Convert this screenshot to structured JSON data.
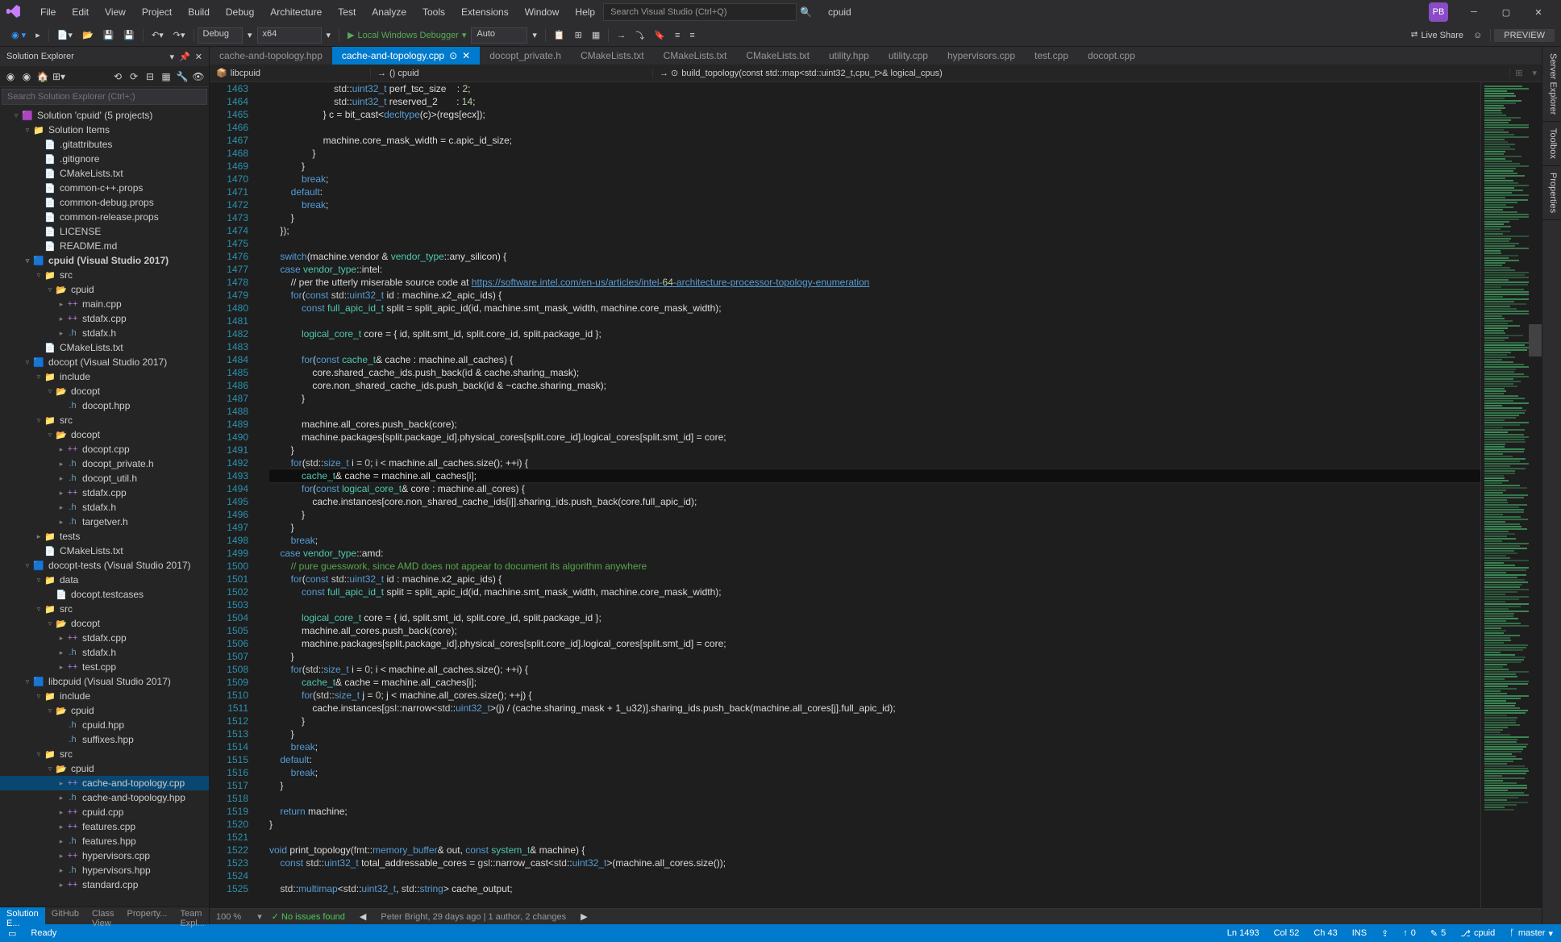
{
  "titlebar": {
    "menus": [
      "File",
      "Edit",
      "View",
      "Project",
      "Build",
      "Debug",
      "Architecture",
      "Test",
      "Analyze",
      "Tools",
      "Extensions",
      "Window",
      "Help"
    ],
    "search_placeholder": "Search Visual Studio (Ctrl+Q)",
    "project_label": "cpuid",
    "user_initials": "PB"
  },
  "toolbar": {
    "config": "Debug",
    "platform": "x64",
    "debug_label": "Local Windows Debugger",
    "debug_mode": "Auto",
    "live_share": "Live Share",
    "preview": "PREVIEW"
  },
  "solution": {
    "title": "Solution Explorer",
    "search_placeholder": "Search Solution Explorer (Ctrl+;)",
    "root": "Solution 'cpuid' (5 projects)",
    "tree": [
      {
        "d": 1,
        "exp": "▿",
        "ic": "sln",
        "t": "Solution 'cpuid' (5 projects)",
        "bold": false
      },
      {
        "d": 2,
        "exp": "▿",
        "ic": "folder",
        "t": "Solution Items"
      },
      {
        "d": 3,
        "exp": "",
        "ic": "file",
        "t": ".gitattributes"
      },
      {
        "d": 3,
        "exp": "",
        "ic": "file",
        "t": ".gitignore"
      },
      {
        "d": 3,
        "exp": "",
        "ic": "file",
        "t": "CMakeLists.txt"
      },
      {
        "d": 3,
        "exp": "",
        "ic": "file",
        "t": "common-c++.props"
      },
      {
        "d": 3,
        "exp": "",
        "ic": "file",
        "t": "common-debug.props"
      },
      {
        "d": 3,
        "exp": "",
        "ic": "file",
        "t": "common-release.props"
      },
      {
        "d": 3,
        "exp": "",
        "ic": "file",
        "t": "LICENSE"
      },
      {
        "d": 3,
        "exp": "",
        "ic": "file",
        "t": "README.md"
      },
      {
        "d": 2,
        "exp": "▿",
        "ic": "proj",
        "t": "cpuid (Visual Studio 2017)",
        "bold": true
      },
      {
        "d": 3,
        "exp": "▿",
        "ic": "folder",
        "t": "src"
      },
      {
        "d": 4,
        "exp": "▿",
        "ic": "folderc",
        "t": "cpuid"
      },
      {
        "d": 5,
        "exp": "▸",
        "ic": "cpp",
        "t": "main.cpp"
      },
      {
        "d": 5,
        "exp": "▸",
        "ic": "cpp",
        "t": "stdafx.cpp"
      },
      {
        "d": 5,
        "exp": "▸",
        "ic": "hpp",
        "t": "stdafx.h"
      },
      {
        "d": 3,
        "exp": "",
        "ic": "file",
        "t": "CMakeLists.txt"
      },
      {
        "d": 2,
        "exp": "▿",
        "ic": "proj",
        "t": "docopt (Visual Studio 2017)"
      },
      {
        "d": 3,
        "exp": "▿",
        "ic": "folder",
        "t": "include"
      },
      {
        "d": 4,
        "exp": "▿",
        "ic": "folderc",
        "t": "docopt"
      },
      {
        "d": 5,
        "exp": "",
        "ic": "hpp",
        "t": "docopt.hpp"
      },
      {
        "d": 3,
        "exp": "▿",
        "ic": "folder",
        "t": "src"
      },
      {
        "d": 4,
        "exp": "▿",
        "ic": "folderc",
        "t": "docopt"
      },
      {
        "d": 5,
        "exp": "▸",
        "ic": "cpp",
        "t": "docopt.cpp"
      },
      {
        "d": 5,
        "exp": "▸",
        "ic": "hpp",
        "t": "docopt_private.h"
      },
      {
        "d": 5,
        "exp": "▸",
        "ic": "hpp",
        "t": "docopt_util.h"
      },
      {
        "d": 5,
        "exp": "▸",
        "ic": "cpp",
        "t": "stdafx.cpp"
      },
      {
        "d": 5,
        "exp": "▸",
        "ic": "hpp",
        "t": "stdafx.h"
      },
      {
        "d": 5,
        "exp": "▸",
        "ic": "hpp",
        "t": "targetver.h"
      },
      {
        "d": 3,
        "exp": "▸",
        "ic": "folder",
        "t": "tests"
      },
      {
        "d": 3,
        "exp": "",
        "ic": "file",
        "t": "CMakeLists.txt"
      },
      {
        "d": 2,
        "exp": "▿",
        "ic": "proj",
        "t": "docopt-tests (Visual Studio 2017)"
      },
      {
        "d": 3,
        "exp": "▿",
        "ic": "folder",
        "t": "data"
      },
      {
        "d": 4,
        "exp": "",
        "ic": "file",
        "t": "docopt.testcases"
      },
      {
        "d": 3,
        "exp": "▿",
        "ic": "folder",
        "t": "src"
      },
      {
        "d": 4,
        "exp": "▿",
        "ic": "folderc",
        "t": "docopt"
      },
      {
        "d": 5,
        "exp": "▸",
        "ic": "cpp",
        "t": "stdafx.cpp"
      },
      {
        "d": 5,
        "exp": "▸",
        "ic": "hpp",
        "t": "stdafx.h"
      },
      {
        "d": 5,
        "exp": "▸",
        "ic": "cpp",
        "t": "test.cpp"
      },
      {
        "d": 2,
        "exp": "▿",
        "ic": "proj",
        "t": "libcpuid (Visual Studio 2017)"
      },
      {
        "d": 3,
        "exp": "▿",
        "ic": "folder",
        "t": "include"
      },
      {
        "d": 4,
        "exp": "▿",
        "ic": "folderc",
        "t": "cpuid"
      },
      {
        "d": 5,
        "exp": "",
        "ic": "hpp",
        "t": "cpuid.hpp"
      },
      {
        "d": 5,
        "exp": "",
        "ic": "hpp",
        "t": "suffixes.hpp"
      },
      {
        "d": 3,
        "exp": "▿",
        "ic": "folder",
        "t": "src"
      },
      {
        "d": 4,
        "exp": "▿",
        "ic": "folderc",
        "t": "cpuid"
      },
      {
        "d": 5,
        "exp": "▸",
        "ic": "cpp",
        "t": "cache-and-topology.cpp",
        "sel": true
      },
      {
        "d": 5,
        "exp": "▸",
        "ic": "hpp",
        "t": "cache-and-topology.hpp"
      },
      {
        "d": 5,
        "exp": "▸",
        "ic": "cpp",
        "t": "cpuid.cpp"
      },
      {
        "d": 5,
        "exp": "▸",
        "ic": "cpp",
        "t": "features.cpp"
      },
      {
        "d": 5,
        "exp": "▸",
        "ic": "hpp",
        "t": "features.hpp"
      },
      {
        "d": 5,
        "exp": "▸",
        "ic": "cpp",
        "t": "hypervisors.cpp"
      },
      {
        "d": 5,
        "exp": "▸",
        "ic": "hpp",
        "t": "hypervisors.hpp"
      },
      {
        "d": 5,
        "exp": "▸",
        "ic": "cpp",
        "t": "standard.cpp"
      }
    ],
    "bottom_tabs": [
      "Solution E...",
      "GitHub",
      "Class View",
      "Property...",
      "Team Expl..."
    ]
  },
  "editor": {
    "tabs": [
      {
        "name": "cache-and-topology.hpp",
        "active": false
      },
      {
        "name": "cache-and-topology.cpp",
        "active": true,
        "close": true,
        "pin": true
      },
      {
        "name": "docopt_private.h",
        "active": false
      },
      {
        "name": "CMakeLists.txt",
        "active": false
      },
      {
        "name": "CMakeLists.txt",
        "active": false
      },
      {
        "name": "CMakeLists.txt",
        "active": false
      },
      {
        "name": "utility.hpp",
        "active": false
      },
      {
        "name": "utility.cpp",
        "active": false
      },
      {
        "name": "hypervisors.cpp",
        "active": false
      },
      {
        "name": "test.cpp",
        "active": false
      },
      {
        "name": "docopt.cpp",
        "active": false
      }
    ],
    "nav": {
      "project": "libcpuid",
      "scope": "() cpuid",
      "member": "build_topology(const std::map<std::uint32_t,cpu_t>& logical_cpus)"
    },
    "first_line": 1463,
    "current_line": 1493,
    "lines": [
      "                        std::uint32_t perf_tsc_size    : 2;",
      "                        std::uint32_t reserved_2       : 14;",
      "                    } c = bit_cast<decltype(c)>(regs[ecx]);",
      "",
      "                    machine.core_mask_width = c.apic_id_size;",
      "                }",
      "            }",
      "            break;",
      "        default:",
      "            break;",
      "        }",
      "    });",
      "",
      "    switch(machine.vendor & vendor_type::any_silicon) {",
      "    case vendor_type::intel:",
      "        // per the utterly miserable source code at https://software.intel.com/en-us/articles/intel-64-architecture-processor-topology-enumeration",
      "        for(const std::uint32_t id : machine.x2_apic_ids) {",
      "            const full_apic_id_t split = split_apic_id(id, machine.smt_mask_width, machine.core_mask_width);",
      "",
      "            logical_core_t core = { id, split.smt_id, split.core_id, split.package_id };",
      "",
      "            for(const cache_t& cache : machine.all_caches) {",
      "                core.shared_cache_ids.push_back(id & cache.sharing_mask);",
      "                core.non_shared_cache_ids.push_back(id & ~cache.sharing_mask);",
      "            }",
      "",
      "            machine.all_cores.push_back(core);",
      "            machine.packages[split.package_id].physical_cores[split.core_id].logical_cores[split.smt_id] = core;",
      "        }",
      "        for(std::size_t i = 0; i < machine.all_caches.size(); ++i) {",
      "            cache_t& cache = machine.all_caches[i];",
      "            for(const logical_core_t& core : machine.all_cores) {",
      "                cache.instances[core.non_shared_cache_ids[i]].sharing_ids.push_back(core.full_apic_id);",
      "            }",
      "        }",
      "        break;",
      "    case vendor_type::amd:",
      "        // pure guesswork, since AMD does not appear to document its algorithm anywhere",
      "        for(const std::uint32_t id : machine.x2_apic_ids) {",
      "            const full_apic_id_t split = split_apic_id(id, machine.smt_mask_width, machine.core_mask_width);",
      "",
      "            logical_core_t core = { id, split.smt_id, split.core_id, split.package_id };",
      "            machine.all_cores.push_back(core);",
      "            machine.packages[split.package_id].physical_cores[split.core_id].logical_cores[split.smt_id] = core;",
      "        }",
      "        for(std::size_t i = 0; i < machine.all_caches.size(); ++i) {",
      "            cache_t& cache = machine.all_caches[i];",
      "            for(std::size_t j = 0; j < machine.all_cores.size(); ++j) {",
      "                cache.instances[gsl::narrow<std::uint32_t>(j) / (cache.sharing_mask + 1_u32)].sharing_ids.push_back(machine.all_cores[j].full_apic_id);",
      "            }",
      "        }",
      "        break;",
      "    default:",
      "        break;",
      "    }",
      "",
      "    return machine;",
      "}",
      "",
      "void print_topology(fmt::memory_buffer& out, const system_t& machine) {",
      "    const std::uint32_t total_addressable_cores = gsl::narrow_cast<std::uint32_t>(machine.all_cores.size());",
      "",
      "    std::multimap<std::uint32_t, std::string> cache_output;"
    ]
  },
  "status_bar": {
    "zoom": "100 %",
    "issues": "No issues found",
    "author": "Peter Bright, 29 days ago | 1 author, 2 changes"
  },
  "bottom_status": {
    "ready": "Ready",
    "ln": "Ln 1493",
    "col": "Col 52",
    "ch": "Ch 43",
    "ins": "INS",
    "up": "0",
    "dn": "5",
    "repo": "cpuid",
    "branch": "master"
  },
  "right_tabs": [
    "Server Explorer",
    "Toolbox",
    "Properties"
  ]
}
